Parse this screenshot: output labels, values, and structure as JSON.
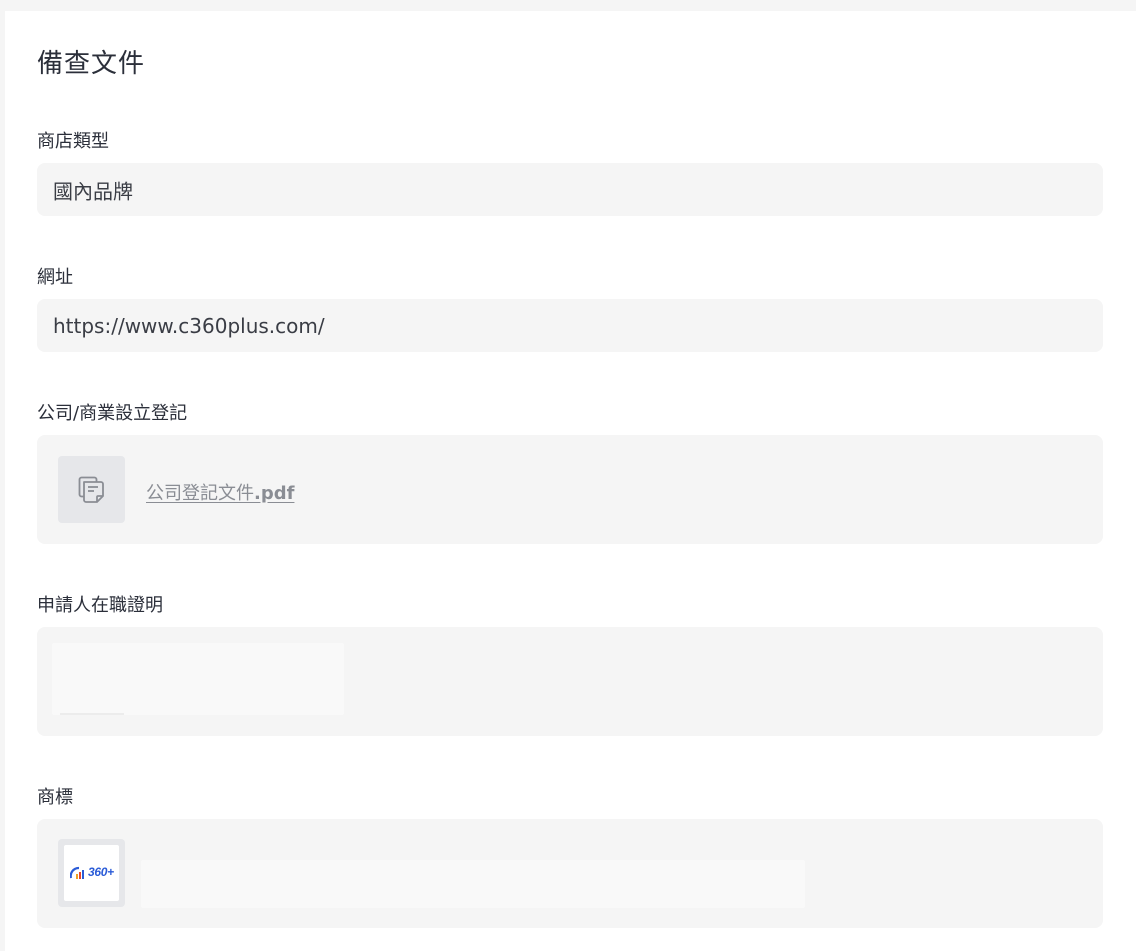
{
  "page": {
    "title": "備查文件"
  },
  "store_type": {
    "label": "商店類型",
    "value": "國內品牌"
  },
  "website": {
    "label": "網址",
    "value": "https://www.c360plus.com/"
  },
  "company_registration": {
    "label": "公司/商業設立登記",
    "file_name": "公司登記文件",
    "file_ext": ".pdf",
    "file_icon": "document-icon"
  },
  "employment_proof": {
    "label": "申請人在職證明"
  },
  "trademark": {
    "label": "商標",
    "logo_text": "360+",
    "logo_colors": {
      "text": "#2a5bd7",
      "bars": [
        "#f0a020",
        "#e8452c",
        "#2a5bd7"
      ]
    }
  }
}
